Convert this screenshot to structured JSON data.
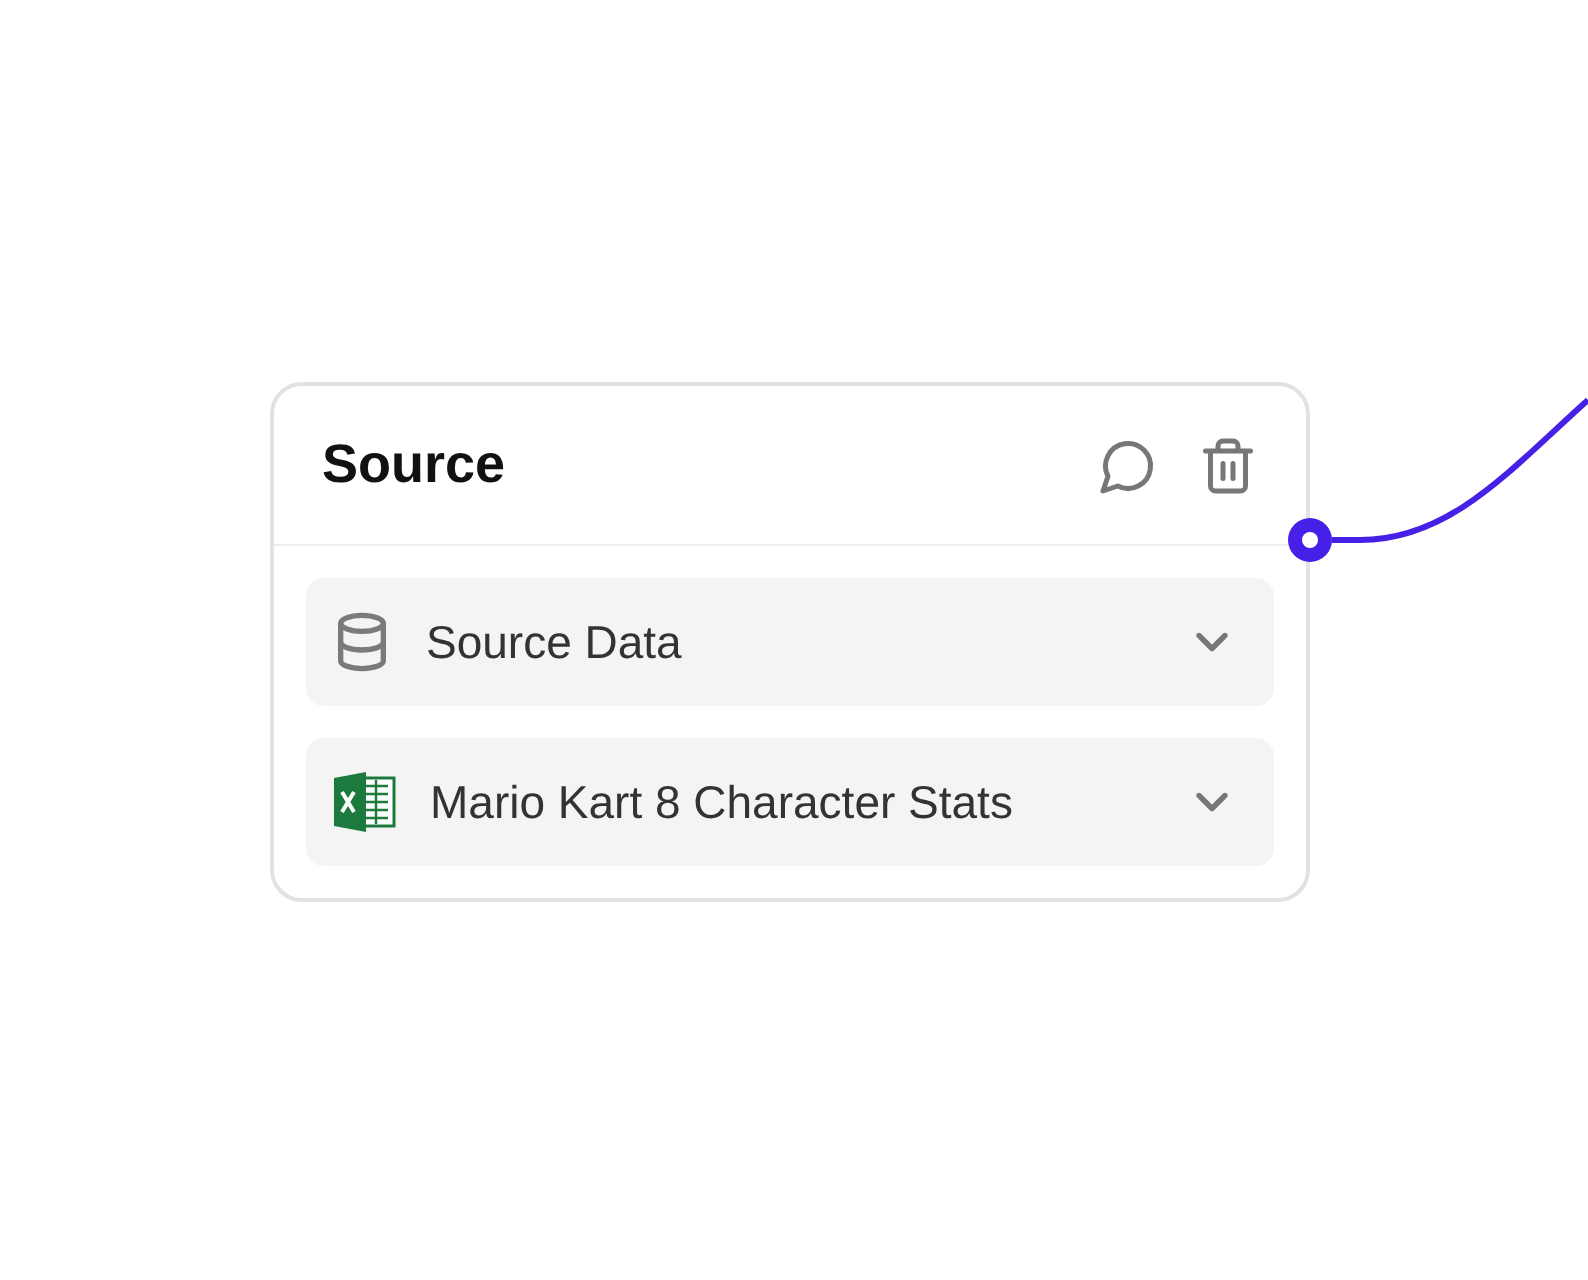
{
  "node": {
    "title": "Source",
    "fields": [
      {
        "kind": "database",
        "label": "Source Data"
      },
      {
        "kind": "spreadsheet",
        "label": "Mario Kart 8 Character Stats"
      }
    ]
  }
}
